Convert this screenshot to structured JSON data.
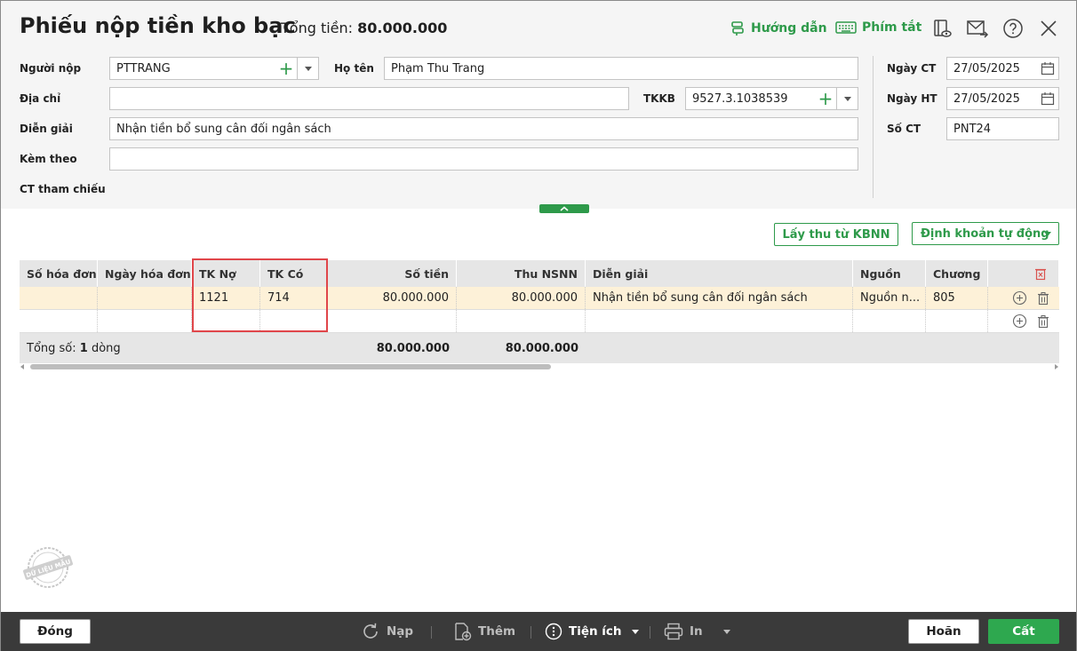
{
  "header": {
    "title": "Phiếu nộp tiền kho bạc",
    "total_label": "Tổng tiền:",
    "total_value": "80.000.000",
    "guide_label": "Hướng dẫn",
    "shortcut_label": "Phím tắt"
  },
  "form": {
    "payer_label": "Người nộp",
    "payer_value": "PTTRANG",
    "fullname_label": "Họ tên",
    "fullname_value": "Phạm Thu Trang",
    "address_label": "Địa chỉ",
    "address_value": "",
    "tkkb_label": "TKKB",
    "tkkb_value": "9527.3.1038539",
    "desc_label": "Diễn giải",
    "desc_value": "Nhận tiền bổ sung cân đối ngân sách",
    "attach_label": "Kèm theo",
    "attach_value": "",
    "ref_label": "CT tham chiếu",
    "date_ct_label": "Ngày CT",
    "date_ct_value": "27/05/2025",
    "date_ht_label": "Ngày HT",
    "date_ht_value": "27/05/2025",
    "so_ct_label": "Số CT",
    "so_ct_value": "PNT24"
  },
  "actions": {
    "fetch_label": "Lấy thu từ KBNN",
    "auto_label": "Định khoản tự động"
  },
  "grid": {
    "columns": [
      "Số hóa đơn",
      "Ngày hóa đơn",
      "TK Nợ",
      "TK Có",
      "Số tiền",
      "Thu NSNN",
      "Diễn giải",
      "Nguồn",
      "Chương"
    ],
    "rows": [
      [
        "",
        "",
        "1121",
        "714",
        "80.000.000",
        "80.000.000",
        "Nhận tiền bổ sung cân đối ngân sách",
        "Nguồn n...",
        "805"
      ]
    ],
    "footer": {
      "total_prefix": "Tổng số: ",
      "total_count": "1",
      "total_suffix": " dòng",
      "sum_amount": "80.000.000",
      "sum_nsnn": "80.000.000"
    }
  },
  "watermark": "DỮ LIỆU MẪU",
  "toolbar": {
    "close_label": "Đóng",
    "reload_label": "Nạp",
    "add_label": "Thêm",
    "utility_label": "Tiện ích",
    "print_label": "In",
    "undo_label": "Hoãn",
    "save_label": "Cất"
  },
  "colors": {
    "accent": "#2e9a4a",
    "highlight_row": "#fdf1d8",
    "annotation": "#e0464a"
  }
}
